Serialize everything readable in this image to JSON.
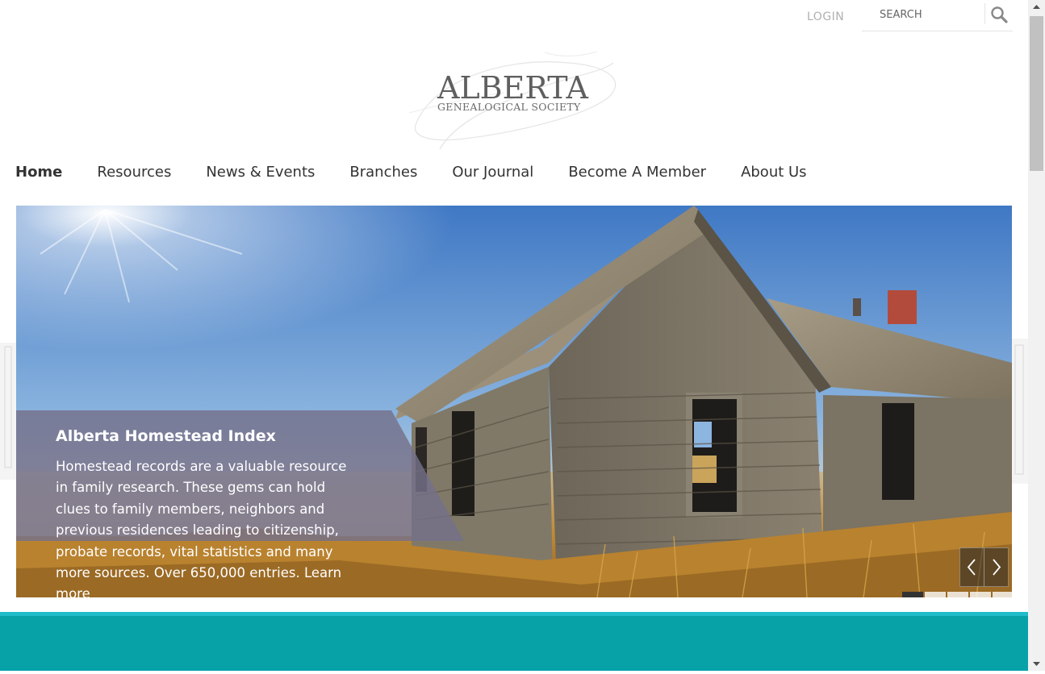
{
  "header": {
    "login_label": "LOGIN",
    "search_placeholder": "SEARCH",
    "search_icon": "search-icon"
  },
  "logo": {
    "line1": "ALBERTA",
    "line2": "GENEALOGICAL SOCIETY"
  },
  "nav": {
    "items": [
      {
        "label": "Home",
        "active": true
      },
      {
        "label": "Resources"
      },
      {
        "label": "News & Events"
      },
      {
        "label": "Branches"
      },
      {
        "label": "Our Journal"
      },
      {
        "label": "Become A Member"
      },
      {
        "label": "About Us"
      }
    ]
  },
  "hero": {
    "title": "Alberta Homestead Index",
    "body": "Homestead records are a valuable resource in family research. These gems can hold clues to family members, neighbors and previous residences leading to citizenship, probate records, vital statistics and many more sources. Over 650,000 entries. Learn more",
    "prev_icon": "chevron-left-icon",
    "next_icon": "chevron-right-icon",
    "slide_count": 5,
    "active_slide": 1
  },
  "colors": {
    "teal_band": "#07a2a8",
    "teal_line": "#1fbcc9",
    "nav_text": "#333333",
    "login_text": "#b0b0b0"
  }
}
